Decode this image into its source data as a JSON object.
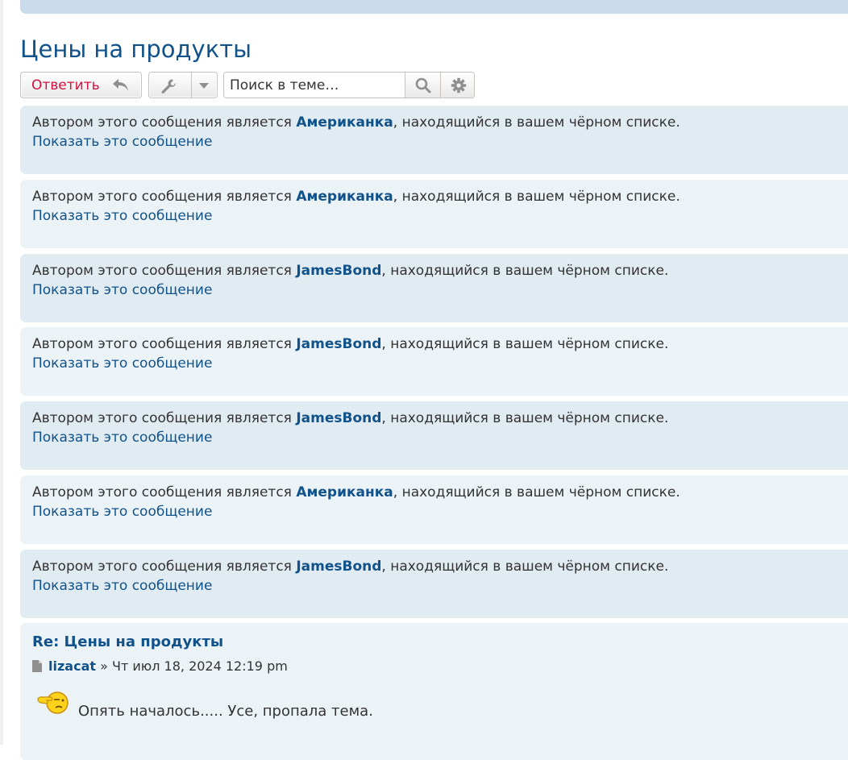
{
  "topic": {
    "title": "Цены на продукты"
  },
  "toolbar": {
    "reply_label": "Ответить",
    "search_placeholder": "Поиск в теме…",
    "icons": [
      "reply-arrow-icon",
      "wrench-icon",
      "caret-down-icon",
      "search-icon",
      "gear-icon"
    ]
  },
  "blocked_posts": [
    {
      "prefix": "Автором этого сообщения является ",
      "author": "Американка",
      "suffix": ", находящийся в вашем чёрном списке.",
      "show_label": "Показать это сообщение"
    },
    {
      "prefix": "Автором этого сообщения является ",
      "author": "Американка",
      "suffix": ", находящийся в вашем чёрном списке.",
      "show_label": "Показать это сообщение"
    },
    {
      "prefix": "Автором этого сообщения является ",
      "author": "JamesBond",
      "suffix": ", находящийся в вашем чёрном списке.",
      "show_label": "Показать это сообщение"
    },
    {
      "prefix": "Автором этого сообщения является ",
      "author": "JamesBond",
      "suffix": ", находящийся в вашем чёрном списке.",
      "show_label": "Показать это сообщение"
    },
    {
      "prefix": "Автором этого сообщения является ",
      "author": "JamesBond",
      "suffix": ", находящийся в вашем чёрном списке.",
      "show_label": "Показать это сообщение"
    },
    {
      "prefix": "Автором этого сообщения является ",
      "author": "Американка",
      "suffix": ", находящийся в вашем чёрном списке.",
      "show_label": "Показать это сообщение"
    },
    {
      "prefix": "Автором этого сообщения является ",
      "author": "JamesBond",
      "suffix": ", находящийся в вашем чёрном списке.",
      "show_label": "Показать это сообщение"
    }
  ],
  "reply_post": {
    "title": "Re: Цены на продукты",
    "author": "lizacat",
    "separator": " » ",
    "date": "Чт июл 18, 2024 12:19 pm",
    "text": "Опять началось..... Усе, пропала тема.",
    "smiley_icon": "facepalm-smiley-icon"
  },
  "colors": {
    "link": "#105289",
    "reply_button": "#d31141",
    "post_bg_a": "#e1ebf2",
    "post_bg_b": "#ecf3f7"
  }
}
